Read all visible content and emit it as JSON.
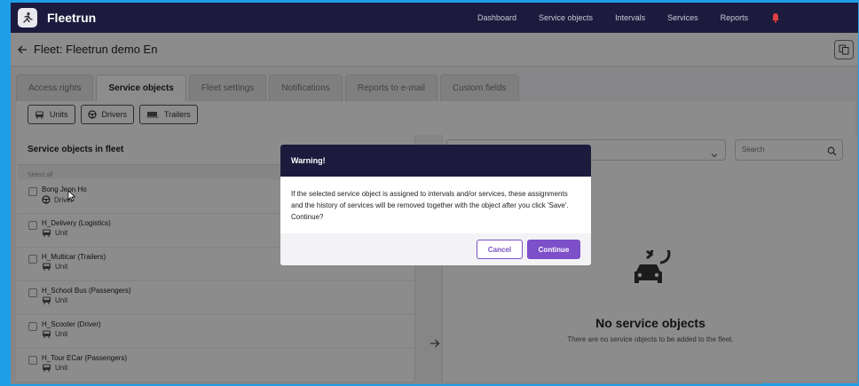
{
  "app": {
    "title": "Fleetrun",
    "logo_icon": "runner-logo-icon"
  },
  "nav": {
    "items": [
      "Dashboard",
      "Service objects",
      "Intervals",
      "Services",
      "Reports"
    ],
    "notification_icon": "bell-icon"
  },
  "page": {
    "title": "Fleet: Fleetrun demo En"
  },
  "tabs": [
    {
      "label": "Access rights",
      "active": false
    },
    {
      "label": "Service objects",
      "active": true
    },
    {
      "label": "Fleet settings",
      "active": false
    },
    {
      "label": "Notifications",
      "active": false
    },
    {
      "label": "Reports to e-mail",
      "active": false
    },
    {
      "label": "Custom fields",
      "active": false
    }
  ],
  "filters": {
    "units": "Units",
    "drivers": "Drivers",
    "trailers": "Trailers"
  },
  "left_panel": {
    "title": "Service objects in fleet",
    "select_all": "Select all",
    "items": [
      {
        "name": "Bong Jeon Ho",
        "type": "Driver"
      },
      {
        "name": "H_Delivery (Logistics)",
        "type": "Unit"
      },
      {
        "name": "H_Multicar (Trailers)",
        "type": "Unit"
      },
      {
        "name": "H_School Bus (Passengers)",
        "type": "Unit"
      },
      {
        "name": "H_Scooter (Driver)",
        "type": "Unit"
      },
      {
        "name": "H_Tour ECar (Passengers)",
        "type": "Unit"
      }
    ]
  },
  "right_panel": {
    "search_placeholder": "Search",
    "empty_title": "No service objects",
    "empty_subtitle": "There are no service objects to be added to the fleet."
  },
  "modal": {
    "title": "Warning!",
    "body": "If the selected service object is assigned to intervals and/or services, these assignments and the history of services will be removed together with the object after you click 'Save'. Continue?",
    "cancel": "Cancel",
    "continue": "Continue"
  },
  "colors": {
    "topbar": "#1c1b3d",
    "accent": "#7d4fc9",
    "frame": "#1f9ee8"
  }
}
